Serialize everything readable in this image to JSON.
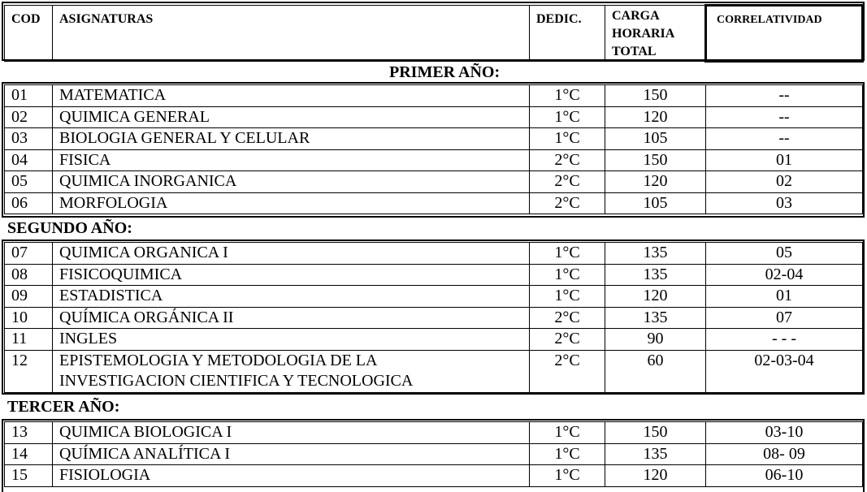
{
  "header": {
    "cod": "COD",
    "asignaturas": "ASIGNATURAS",
    "dedic": "DEDIC.",
    "carga_l1": "CARGA",
    "carga_l2": "HORARIA",
    "carga_l3": "TOTAL",
    "correlatividad": "CORRELATIVIDAD"
  },
  "sections": [
    {
      "title": "PRIMER AÑO:",
      "rows": [
        {
          "cod": "01",
          "name": "MATEMATICA",
          "dedic": "1°C",
          "carga": "150",
          "corr": "--"
        },
        {
          "cod": "02",
          "name": "QUIMICA GENERAL",
          "dedic": "1°C",
          "carga": "120",
          "corr": "--"
        },
        {
          "cod": "03",
          "name": "BIOLOGIA GENERAL Y CELULAR",
          "dedic": "1°C",
          "carga": "105",
          "corr": "--"
        },
        {
          "cod": "04",
          "name": "FISICA",
          "dedic": "2°C",
          "carga": "150",
          "corr": "01"
        },
        {
          "cod": "05",
          "name": "QUIMICA INORGANICA",
          "dedic": "2°C",
          "carga": "120",
          "corr": "02"
        },
        {
          "cod": "06",
          "name": "MORFOLOGIA",
          "dedic": "2°C",
          "carga": "105",
          "corr": "03"
        }
      ]
    },
    {
      "title": "SEGUNDO AÑO:",
      "rows": [
        {
          "cod": "07",
          "name": "QUIMICA ORGANICA I",
          "dedic": "1°C",
          "carga": "135",
          "corr": "05"
        },
        {
          "cod": "08",
          "name": "FISICOQUIMICA",
          "dedic": "1°C",
          "carga": "135",
          "corr": "02-04"
        },
        {
          "cod": "09",
          "name": "ESTADISTICA",
          "dedic": "1°C",
          "carga": "120",
          "corr": "01"
        },
        {
          "cod": "10",
          "name": "QUÍMICA ORGÁNICA II",
          "dedic": "2°C",
          "carga": "135",
          "corr": "07"
        },
        {
          "cod": "11",
          "name": "INGLES",
          "dedic": "2°C",
          "carga": "90",
          "corr": "- - -"
        },
        {
          "cod": "12",
          "name": "EPISTEMOLOGIA Y METODOLOGIA DE LA",
          "name2": "INVESTIGACION CIENTIFICA Y TECNOLOGICA",
          "dedic": "2°C",
          "carga": "60",
          "corr": "02-03-04"
        }
      ]
    },
    {
      "title": "TERCER AÑO:",
      "rows": [
        {
          "cod": "13",
          "name": "QUIMICA BIOLOGICA I",
          "dedic": "1°C",
          "carga": "150",
          "corr": "03-10"
        },
        {
          "cod": "14",
          "name": "QUÍMICA ANALÍTICA I",
          "dedic": "1°C",
          "carga": "135",
          "corr": "08- 09"
        },
        {
          "cod": "15",
          "name": "FISIOLOGIA",
          "dedic": "1°C",
          "carga": "120",
          "corr": "06-10"
        }
      ]
    }
  ]
}
